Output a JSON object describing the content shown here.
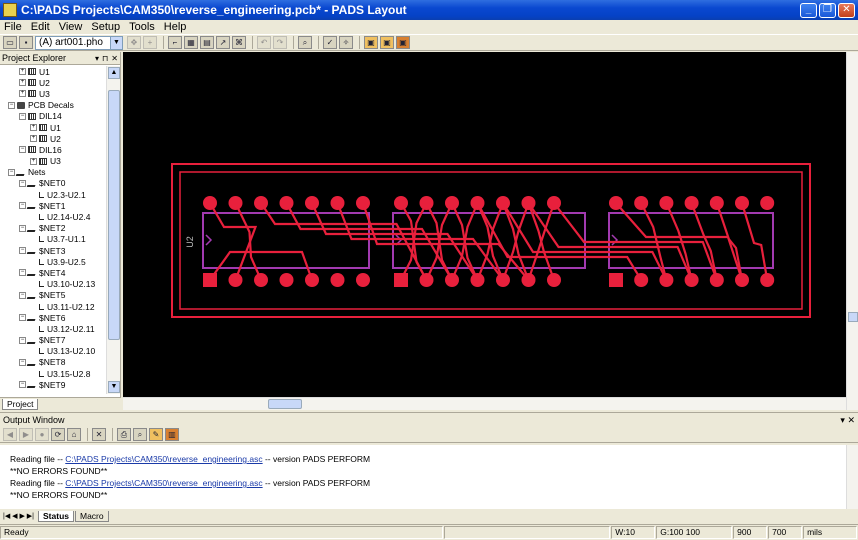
{
  "window": {
    "title": "C:\\PADS Projects\\CAM350\\reverse_engineering.pcb* - PADS Layout",
    "minimize": "_",
    "maximize": "❐",
    "close": "✕"
  },
  "menu": [
    "File",
    "Edit",
    "View",
    "Setup",
    "Tools",
    "Help"
  ],
  "toolbar": {
    "layer_select": "(A) art001.pho"
  },
  "explorer": {
    "title": "Project Explorer",
    "tab": "Project",
    "nodes": [
      {
        "indent": 2,
        "exp": "+",
        "icon": "comp",
        "label": "U1"
      },
      {
        "indent": 2,
        "exp": "+",
        "icon": "comp",
        "label": "U2"
      },
      {
        "indent": 2,
        "exp": "+",
        "icon": "comp",
        "label": "U3"
      },
      {
        "indent": 1,
        "exp": "-",
        "icon": "folder",
        "label": "PCB Decals"
      },
      {
        "indent": 2,
        "exp": "-",
        "icon": "comp",
        "label": "DIL14"
      },
      {
        "indent": 3,
        "exp": "+",
        "icon": "comp",
        "label": "U1"
      },
      {
        "indent": 3,
        "exp": "+",
        "icon": "comp",
        "label": "U2"
      },
      {
        "indent": 2,
        "exp": "-",
        "icon": "comp",
        "label": "DIL16"
      },
      {
        "indent": 3,
        "exp": "+",
        "icon": "comp",
        "label": "U3"
      },
      {
        "indent": 1,
        "exp": "-",
        "icon": "net",
        "label": "Nets"
      },
      {
        "indent": 2,
        "exp": "-",
        "icon": "net",
        "label": "$NET0"
      },
      {
        "indent": 3,
        "exp": "",
        "icon": "conn",
        "label": "U2.3-U2.1"
      },
      {
        "indent": 2,
        "exp": "-",
        "icon": "net",
        "label": "$NET1"
      },
      {
        "indent": 3,
        "exp": "",
        "icon": "conn",
        "label": "U2.14-U2.4"
      },
      {
        "indent": 2,
        "exp": "-",
        "icon": "net",
        "label": "$NET2"
      },
      {
        "indent": 3,
        "exp": "",
        "icon": "conn",
        "label": "U3.7-U1.1"
      },
      {
        "indent": 2,
        "exp": "-",
        "icon": "net",
        "label": "$NET3"
      },
      {
        "indent": 3,
        "exp": "",
        "icon": "conn",
        "label": "U3.9-U2.5"
      },
      {
        "indent": 2,
        "exp": "-",
        "icon": "net",
        "label": "$NET4"
      },
      {
        "indent": 3,
        "exp": "",
        "icon": "conn",
        "label": "U3.10-U2.13"
      },
      {
        "indent": 2,
        "exp": "-",
        "icon": "net",
        "label": "$NET5"
      },
      {
        "indent": 3,
        "exp": "",
        "icon": "conn",
        "label": "U3.11-U2.12"
      },
      {
        "indent": 2,
        "exp": "-",
        "icon": "net",
        "label": "$NET6"
      },
      {
        "indent": 3,
        "exp": "",
        "icon": "conn",
        "label": "U3.12-U2.11"
      },
      {
        "indent": 2,
        "exp": "-",
        "icon": "net",
        "label": "$NET7"
      },
      {
        "indent": 3,
        "exp": "",
        "icon": "conn",
        "label": "U3.13-U2.10"
      },
      {
        "indent": 2,
        "exp": "-",
        "icon": "net",
        "label": "$NET8"
      },
      {
        "indent": 3,
        "exp": "",
        "icon": "conn",
        "label": "U3.15-U2.8"
      },
      {
        "indent": 2,
        "exp": "-",
        "icon": "net",
        "label": "$NET9"
      }
    ]
  },
  "board": {
    "refdes": "U2",
    "colors": {
      "copper": "#e8203c",
      "outline": "#a23ab0",
      "background": "#000000"
    }
  },
  "output": {
    "title": "Output Window",
    "lines": [
      {
        "prefix": "Reading file -- ",
        "link": "C:\\PADS Projects\\CAM350\\reverse_engineering.asc",
        "suffix": " -- version PADS PERFORM"
      },
      {
        "prefix": "**NO ERRORS FOUND**",
        "link": "",
        "suffix": ""
      },
      {
        "prefix": "Reading file -- ",
        "link": "C:\\PADS Projects\\CAM350\\reverse_engineering.asc",
        "suffix": " -- version PADS PERFORM"
      },
      {
        "prefix": "**NO ERRORS FOUND**",
        "link": "",
        "suffix": ""
      }
    ],
    "tabs": [
      "Status",
      "Macro"
    ]
  },
  "status": {
    "text": "Ready",
    "width": "W:10",
    "grid": "G:100 100",
    "x": "900",
    "y": "700",
    "units": "mils"
  }
}
